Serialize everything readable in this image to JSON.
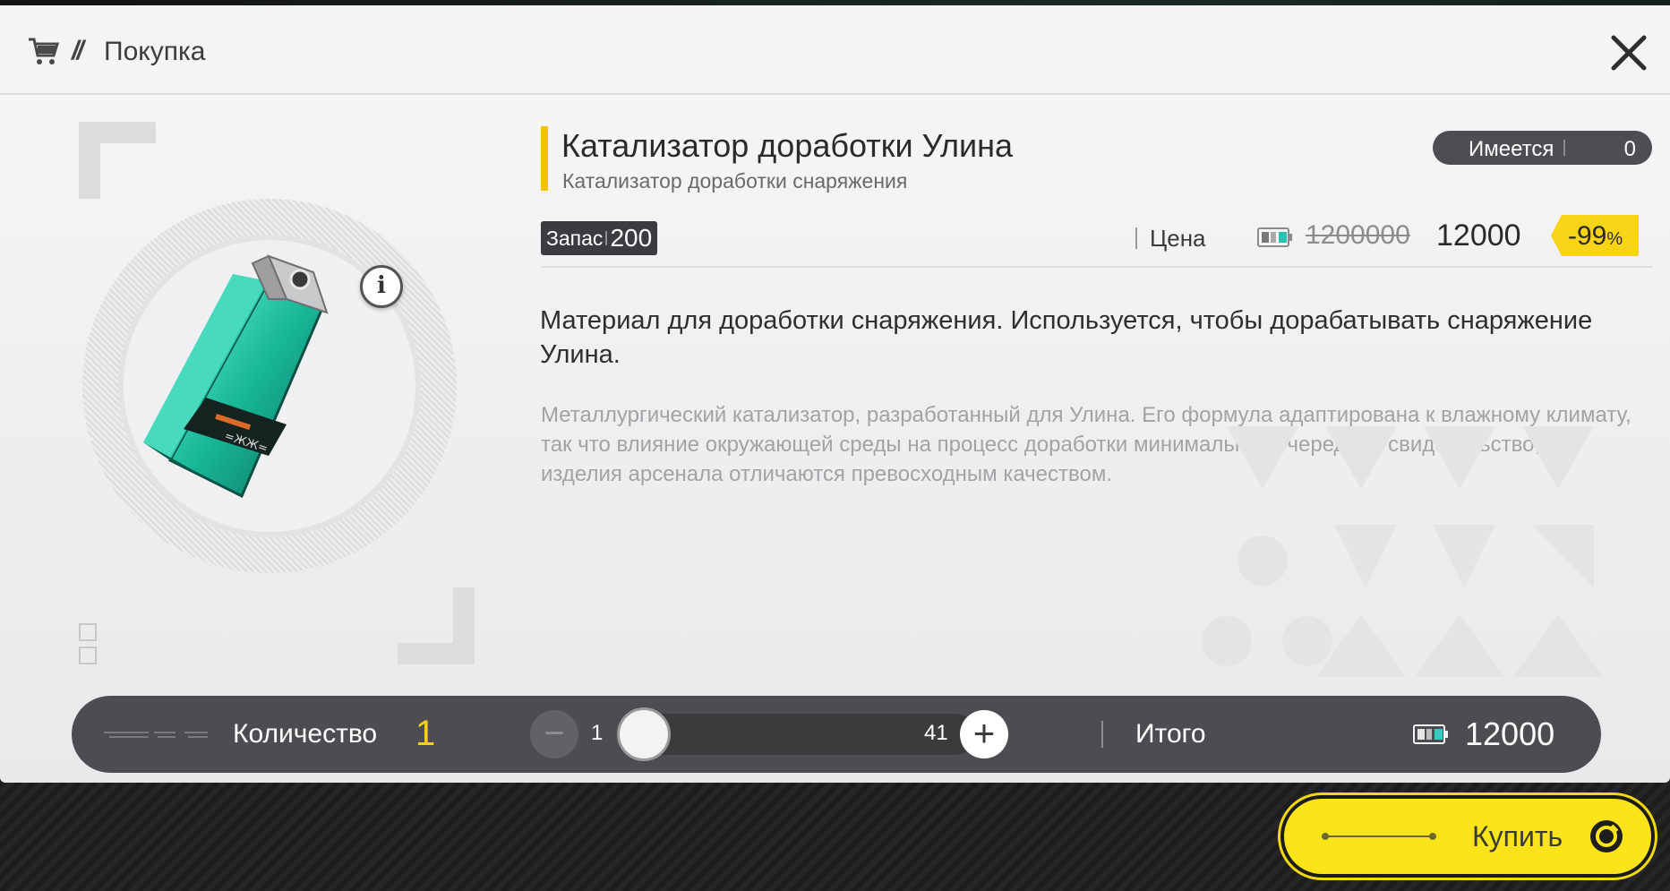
{
  "header": {
    "title": "Покупка",
    "slash": "//",
    "cart_icon": "cart-icon",
    "close_icon": "close-icon"
  },
  "item": {
    "name": "Катализатор доработки Улина",
    "subtitle": "Катализатор доработки снаряжения",
    "owned_label": "Имеется",
    "owned_value": "0",
    "stock_label": "Запас",
    "stock_value": "200",
    "info_icon": "i"
  },
  "price": {
    "label": "Цена",
    "old_price": "1200000",
    "new_price": "12000",
    "discount": "-99",
    "discount_unit": "%",
    "currency_icon": "credit-battery-icon"
  },
  "description": {
    "main": "Материал для доработки снаряжения. Используется, чтобы дорабатывать снаряжение Улина.",
    "lore": "Металлургический катализатор, разработанный для Улина. Его формула адаптирована к влажному климату, так что влияние окружающей среды на процесс доработки минимально. Очередное свидетельство, что изделия арсенала отличаются превосходным качеством."
  },
  "quantity": {
    "label": "Количество",
    "value": "1",
    "slider_min": "1",
    "slider_max": "41",
    "slider_fraction": 0,
    "minus": "−",
    "plus": "+"
  },
  "total": {
    "label": "Итого",
    "value": "12000"
  },
  "buy": {
    "label": "Купить"
  },
  "colors": {
    "accent_yellow": "#f5c400",
    "buy_yellow": "#fbe51a",
    "bar_gray": "#4d4d51",
    "item_teal": "#1fc9a8"
  }
}
